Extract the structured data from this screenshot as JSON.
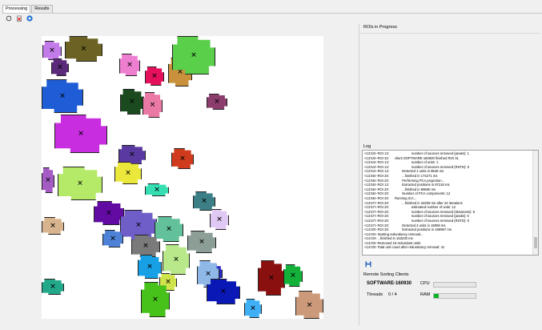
{
  "tabs": [
    {
      "label": "Processing",
      "active": true
    },
    {
      "label": "Results",
      "active": false
    }
  ],
  "toolbar": {
    "icons": [
      "refresh-icon",
      "delete-icon",
      "play-icon"
    ]
  },
  "panels": {
    "rois_in_progress": "ROIs in Progress",
    "log_title": "Log",
    "remote_clients_title": "Remote Sorting Clients"
  },
  "log_lines": [
    "<13:53> ROI 13:                        number of sources removed (peaks): 1",
    "<13:53> ROI 32:      client SOFTWARE-160930 finished ROI 31",
    "<13:54> ROI 13:                        number of units: 1",
    "<13:54> ROI 13:                        number of sources removed (RSTD): 0",
    "<13:54> ROI 13:              Detected 1 units in 9546 ms",
    "<13:55> ROI 20:              ...finished in 174271 ms",
    "<13:55> ROI 20:              Performing PCA projection...",
    "<13:55> ROI 13:              Extracted positions in 87218 ms",
    "<13:56> ROI 20:              ...finished in 89660 ms",
    "<13:56> ROI 20:              Number of PCA components: 12",
    "<13:56> ROI 20:      Running ICA...",
    "<13:57> ROI 20:              ...finished in 34209 ms after 24 iterations",
    "<13:57> ROI 20:                        estimated number of units: 12",
    "<13:57> ROI 20:                        number of sources removed (skewness): 9",
    "<13:57> ROI 20:                        number of sources removed (peaks): 0",
    "<13:57> ROI 20:                        number of sources removed (RSTD): 0",
    "<13:57> ROI 20:              Detected 3 units in 19059 ms",
    "<14:00> ROI 20:              Extracted positions in 168957 ms",
    "<14:00> Starting redundancy removal...",
    "<14:03> ...finished in 163230 ms",
    "<14:03> Removed 16 redundant units",
    "<14:03> Total unit count after redundancy removal: 41"
  ],
  "client": {
    "name": "SOFTWARE-160930",
    "threads_label": "Threads",
    "threads_value": "0 / 4",
    "cpu_label": "CPU",
    "ram_label": "RAM",
    "cpu_usage": 0,
    "ram_usage": 0.12
  },
  "roi_marker": "✕",
  "colors": {
    "ram_bar": "#06b025",
    "accent": "#0078d7"
  },
  "rois": [
    {
      "color": "#c27be8"
    },
    {
      "color": "#6b6223"
    },
    {
      "color": "#5b2a7a"
    },
    {
      "color": "#ee7fd0"
    },
    {
      "color": "#e5105c"
    },
    {
      "color": "#c9913b"
    },
    {
      "color": "#59cf4a"
    },
    {
      "color": "#1f5dd6"
    },
    {
      "color": "#1c4a1f"
    },
    {
      "color": "#ea7aa5"
    },
    {
      "color": "#8c3d6e"
    },
    {
      "color": "#c82ee0"
    },
    {
      "color": "#5a3aa0"
    },
    {
      "color": "#cf3b1c"
    },
    {
      "color": "#ebe73b"
    },
    {
      "color": "#a45bc4"
    },
    {
      "color": "#b4ea68"
    },
    {
      "color": "#36dfb2"
    },
    {
      "color": "#3d7f86"
    },
    {
      "color": "#620ba3"
    },
    {
      "color": "#dfc8f3"
    },
    {
      "color": "#d8b48e"
    },
    {
      "color": "#6f5ec8"
    },
    {
      "color": "#62c09a"
    },
    {
      "color": "#4d82d6"
    },
    {
      "color": "#8c9e96"
    },
    {
      "color": "#7a7a7a"
    },
    {
      "color": "#b8e88a"
    },
    {
      "color": "#18a0e6"
    },
    {
      "color": "#2a2acb"
    },
    {
      "color": "#8fb8e8"
    },
    {
      "color": "#cfe34a"
    },
    {
      "color": "#0a18b5"
    },
    {
      "color": "#8a1010"
    },
    {
      "color": "#13b03a"
    },
    {
      "color": "#24a88a"
    },
    {
      "color": "#46c21a"
    },
    {
      "color": "#3fb0f6"
    },
    {
      "color": "#cc9a7a"
    }
  ]
}
